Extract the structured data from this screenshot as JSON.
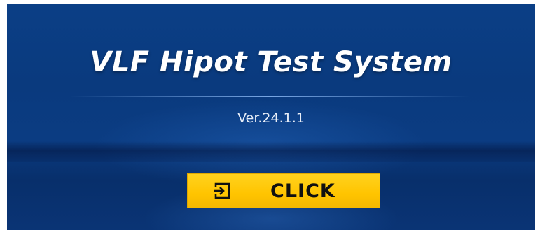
{
  "app": {
    "title": "VLF Hipot Test System",
    "version": "Ver.24.1.1"
  },
  "action": {
    "button_label": "CLICK",
    "button_icon": "login-icon"
  },
  "colors": {
    "background": "#0b3f86",
    "button": "#ffc400",
    "button_text": "#101010",
    "title_text": "#ffffff"
  }
}
